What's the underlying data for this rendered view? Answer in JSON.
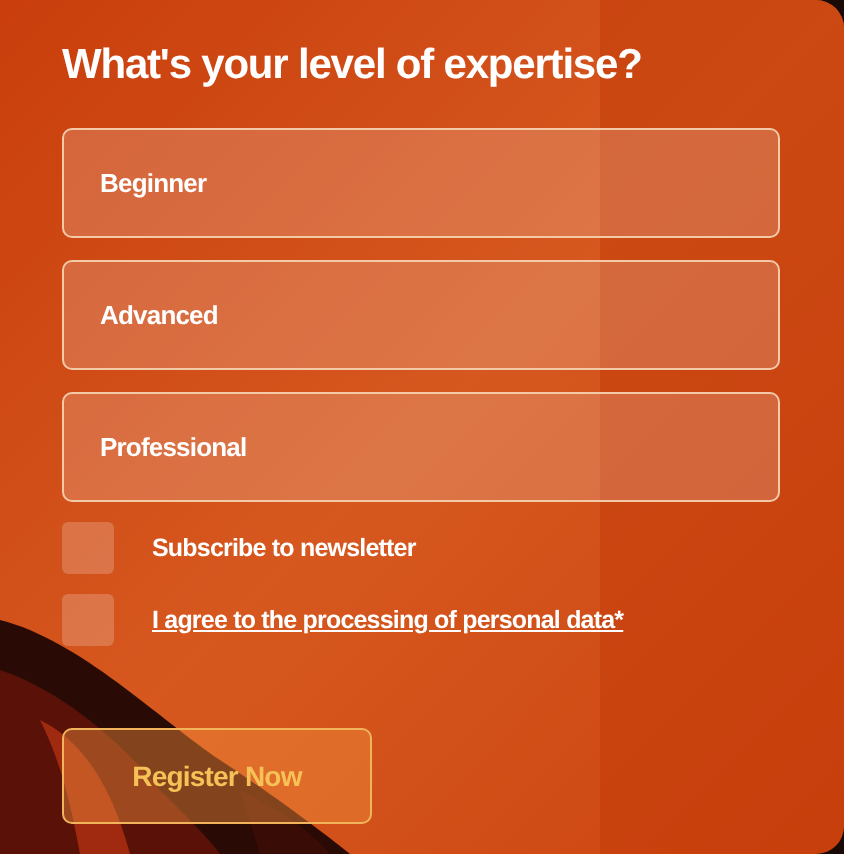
{
  "title": "What's your level of expertise?",
  "options": [
    {
      "label": "Beginner",
      "selected": false
    },
    {
      "label": "Advanced",
      "selected": false
    },
    {
      "label": "Professional",
      "selected": false
    }
  ],
  "checkboxes": [
    {
      "label": "Subscribe to newsletter",
      "checked": false,
      "kind": "text"
    },
    {
      "label": "I agree to the processing of personal data*",
      "checked": false,
      "kind": "link"
    }
  ],
  "button": "Register Now"
}
